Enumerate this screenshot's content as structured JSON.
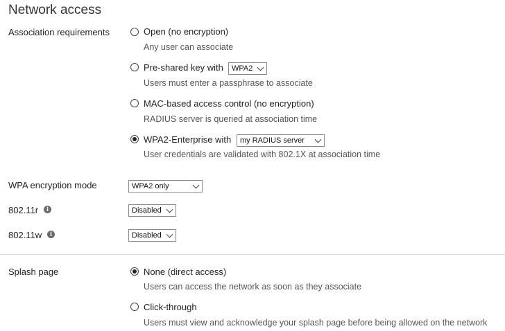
{
  "title": "Network access",
  "association": {
    "label": "Association requirements",
    "options": [
      {
        "label": "Open (no encryption)",
        "description": "Any user can associate",
        "checked": false
      },
      {
        "label": "Pre-shared key with",
        "select": "WPA2",
        "description": "Users must enter a passphrase to associate",
        "checked": false
      },
      {
        "label": "MAC-based access control (no encryption)",
        "description": "RADIUS server is queried at association time",
        "checked": false
      },
      {
        "label": "WPA2-Enterprise with",
        "select": "my RADIUS server",
        "description": "User credentials are validated with 802.1X at association time",
        "checked": true
      }
    ]
  },
  "wpa_mode": {
    "label": "WPA encryption mode",
    "value": "WPA2 only"
  },
  "r80211": {
    "label": "802.11r",
    "value": "Disabled",
    "info_icon": "info-icon"
  },
  "w80211": {
    "label": "802.11w",
    "value": "Disabled",
    "info_icon": "info-icon"
  },
  "splash": {
    "label": "Splash page",
    "options": [
      {
        "label": "None (direct access)",
        "description": "Users can access the network as soon as they associate",
        "checked": true
      },
      {
        "label": "Click-through",
        "description": "Users must view and acknowledge your splash page before being allowed on the network",
        "checked": false
      }
    ]
  }
}
